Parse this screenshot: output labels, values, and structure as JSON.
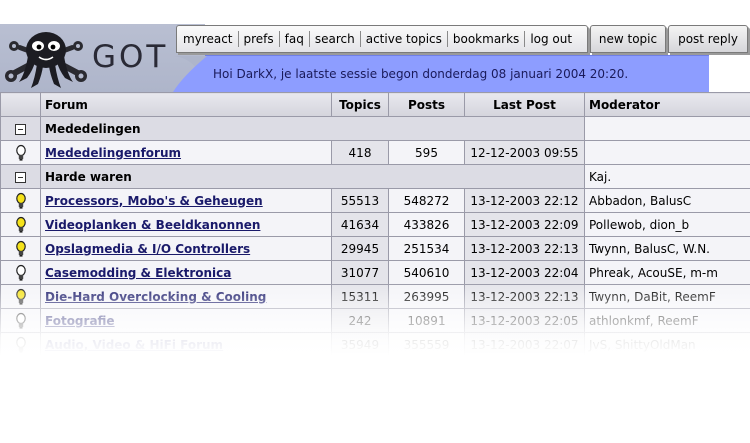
{
  "logo": {
    "text": "GOT"
  },
  "nav": {
    "items": [
      "myreact",
      "prefs",
      "faq",
      "search",
      "active topics",
      "bookmarks",
      "log out"
    ],
    "new_topic": "new topic",
    "post_reply": "post reply"
  },
  "greeting": "Hoi DarkX, je laatste sessie begon donderdag 08 januari 2004 20:20.",
  "table": {
    "headers": {
      "forum": "Forum",
      "topics": "Topics",
      "posts": "Posts",
      "last_post": "Last Post",
      "moderator": "Moderator"
    },
    "categories": [
      {
        "name": "Mededelingen",
        "moderator": "",
        "forums": [
          {
            "name": "Mededelingenforum",
            "topics": "418",
            "posts": "595",
            "last_post": "12-12-2003 09:55",
            "moderator": "",
            "new_posts": false
          }
        ]
      },
      {
        "name": "Harde waren",
        "moderator": "Kaj.",
        "forums": [
          {
            "name": "Processors, Mobo's & Geheugen",
            "topics": "55513",
            "posts": "548272",
            "last_post": "13-12-2003 22:12",
            "moderator": "Abbadon, BalusC",
            "new_posts": true
          },
          {
            "name": "Videoplanken & Beeldkanonnen",
            "topics": "41634",
            "posts": "433826",
            "last_post": "13-12-2003 22:09",
            "moderator": "Pollewob, dion_b",
            "new_posts": true
          },
          {
            "name": "Opslagmedia & I/O Controllers",
            "topics": "29945",
            "posts": "251534",
            "last_post": "13-12-2003 22:13",
            "moderator": "Twynn, BalusC, W.N.",
            "new_posts": true
          },
          {
            "name": "Casemodding & Elektronica",
            "topics": "31077",
            "posts": "540610",
            "last_post": "13-12-2003 22:04",
            "moderator": "Phreak, AcouSE, m-m",
            "new_posts": false
          },
          {
            "name": "Die-Hard Overclocking & Cooling",
            "topics": "15311",
            "posts": "263995",
            "last_post": "13-12-2003 22:13",
            "moderator": "Twynn, DaBit, ReemF",
            "new_posts": true
          },
          {
            "name": "Fotografie",
            "topics": "242",
            "posts": "10891",
            "last_post": "13-12-2003 22:05",
            "moderator": "athlonkmf, ReemF",
            "new_posts": false
          },
          {
            "name": "Audio, Video & HiFi Forum",
            "topics": "35949",
            "posts": "355559",
            "last_post": "13-12-2003 22:07",
            "moderator": "JvS, ShittyOldMan",
            "new_posts": false
          }
        ]
      }
    ]
  },
  "colors": {
    "accent_blue": "#8d9dff",
    "link": "#1a1a6a",
    "bulb_on": "#f5e21a"
  },
  "icons": {
    "collapse": "minus-box-icon",
    "forum": "lightbulb-icon",
    "mascot": "octopus-wrench-icon"
  }
}
